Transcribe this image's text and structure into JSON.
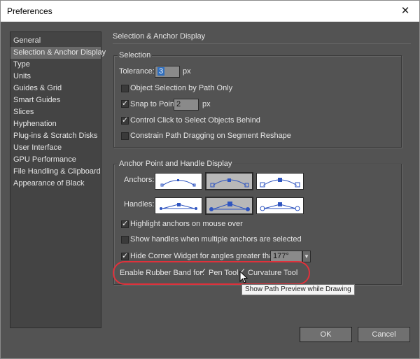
{
  "window": {
    "title": "Preferences",
    "close_glyph": "✕"
  },
  "sidebar": {
    "items": [
      "General",
      "Selection & Anchor Display",
      "Type",
      "Units",
      "Guides & Grid",
      "Smart Guides",
      "Slices",
      "Hyphenation",
      "Plug-ins & Scratch Disks",
      "User Interface",
      "GPU Performance",
      "File Handling & Clipboard",
      "Appearance of Black"
    ],
    "selected_index": 1
  },
  "page": {
    "title": "Selection & Anchor Display"
  },
  "selection": {
    "group_label": "Selection",
    "tolerance_label": "Tolerance:",
    "tolerance_value": "3",
    "tolerance_unit": "px",
    "object_selection_label": "Object Selection by Path Only",
    "object_selection_checked": false,
    "snap_label": "Snap to Point",
    "snap_checked": true,
    "snap_value": "2",
    "snap_unit": "px",
    "ctrl_click_label": "Control Click to Select Objects Behind",
    "ctrl_click_checked": true,
    "constrain_label": "Constrain Path Dragging on Segment Reshape",
    "constrain_checked": false
  },
  "anchor": {
    "group_label": "Anchor Point and Handle Display",
    "anchors_label": "Anchors:",
    "anchors_selected": 1,
    "handles_label": "Handles:",
    "handles_selected": 1,
    "highlight_label": "Highlight anchors on mouse over",
    "highlight_checked": true,
    "show_handles_label": "Show handles when multiple anchors are selected",
    "show_handles_checked": false,
    "corner_label": "Hide Corner Widget for angles greater than:",
    "corner_checked": true,
    "corner_value": "177°",
    "rubber_band_label": "Enable Rubber Band for:",
    "pen_tool_label": "Pen Tool",
    "pen_tool_checked": true,
    "curvature_label": "Curvature Tool",
    "curvature_checked": true
  },
  "tooltip": "Show Path Preview while Drawing",
  "buttons": {
    "ok": "OK",
    "cancel": "Cancel"
  },
  "colors": {
    "highlight_ring": "#e0313b",
    "dialog_bg": "#535353",
    "field_focus": "#2f6ebd"
  }
}
